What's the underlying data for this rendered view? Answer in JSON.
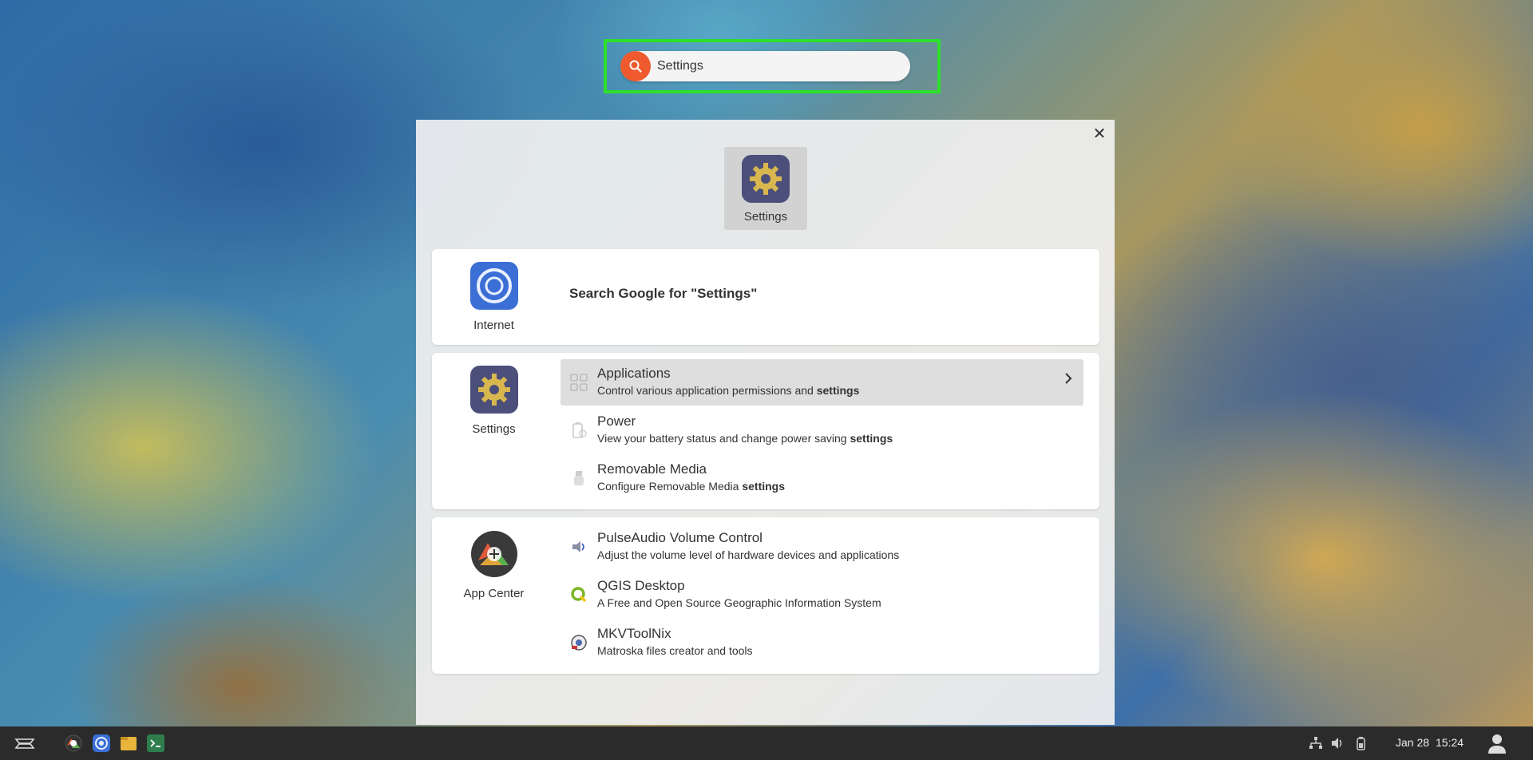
{
  "search": {
    "value": "Settings",
    "placeholder": ""
  },
  "top_result": {
    "label": "Settings",
    "icon": "settings-gear-icon"
  },
  "internet_card": {
    "app_label": "Internet",
    "app_icon": "chromium-icon",
    "action_text": "Search Google for \"Settings\""
  },
  "settings_card": {
    "app_label": "Settings",
    "app_icon": "settings-gear-icon",
    "items": [
      {
        "title": "Applications",
        "desc_prefix": "Control various application permissions and ",
        "desc_bold": "settings",
        "icon": "apps-grid-icon",
        "selected": true
      },
      {
        "title": "Power",
        "desc_prefix": "View your battery status and change power saving ",
        "desc_bold": "settings",
        "icon": "battery-icon",
        "selected": false
      },
      {
        "title": "Removable Media",
        "desc_prefix": "Configure Removable Media ",
        "desc_bold": "settings",
        "icon": "usb-drive-icon",
        "selected": false
      }
    ]
  },
  "appcenter_card": {
    "app_label": "App Center",
    "app_icon": "app-center-icon",
    "items": [
      {
        "title": "PulseAudio Volume Control",
        "desc": "Adjust the volume level of hardware devices and applications",
        "icon": "speaker-icon"
      },
      {
        "title": "QGIS Desktop",
        "desc": "A Free and Open Source Geographic Information System",
        "icon": "qgis-icon"
      },
      {
        "title": "MKVToolNix",
        "desc": "Matroska files creator and tools",
        "icon": "mkvtoolnix-icon"
      }
    ]
  },
  "taskbar": {
    "launcher_icon": "zorin-logo-icon",
    "apps": [
      "software-icon",
      "chromium-icon",
      "files-icon",
      "terminal-icon"
    ],
    "tray": [
      "network-icon",
      "volume-icon",
      "battery-icon"
    ],
    "date": "Jan 28",
    "time": "15:24",
    "user_icon": "user-avatar-icon"
  },
  "colors": {
    "accent": "#ee5a2e",
    "highlight": "#2ce02c",
    "panel": "#f0f0f0",
    "taskbar": "#2b2b2b"
  }
}
